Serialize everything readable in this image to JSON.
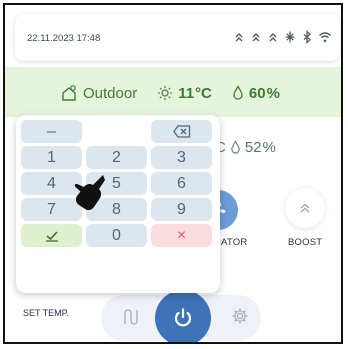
{
  "status_bar": {
    "datetime": "22.11.2023 17:48",
    "icons": [
      "heating-wave-icon",
      "heating-wave-icon",
      "heating-wave-icon",
      "snowflake-icon",
      "bluetooth-icon",
      "wifi-icon"
    ]
  },
  "outdoor": {
    "label": "Outdoor",
    "temperature": "11",
    "temperature_unit": "°C",
    "humidity": "60",
    "humidity_unit": "%",
    "icons": [
      "home-outdoor-icon",
      "sun-icon",
      "droplet-icon"
    ]
  },
  "indoor": {
    "humidity_lead": "C",
    "humidity": "52",
    "humidity_unit": "%"
  },
  "modes": {
    "ventilator_label": "RATOR",
    "boost_label": "BOOST"
  },
  "bottom": {
    "set_temp_label": "SET TEMP."
  },
  "numpad": {
    "minus": "–",
    "display_value": "",
    "backspace_icon": "backspace-icon",
    "keys": [
      "1",
      "2",
      "3",
      "4",
      "5",
      "6",
      "7",
      "8",
      "9"
    ],
    "zero": "0",
    "confirm_icon": "check-icon",
    "cancel": "×"
  },
  "colors": {
    "outdoor_band": "#e4f5dc",
    "outdoor_text": "#3f7a34",
    "key_bg": "#dce6ee",
    "key_text": "#52677a",
    "confirm_bg": "#dff0cf",
    "cancel_bg": "#fadcdf",
    "cancel_text": "#e05a64",
    "power_blue": "#3f73b8"
  }
}
